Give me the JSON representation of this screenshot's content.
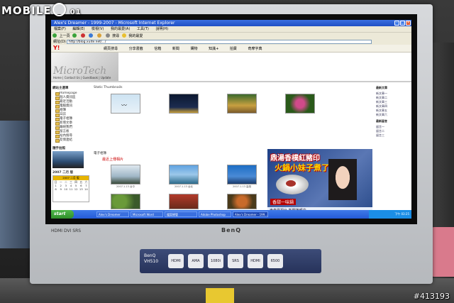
{
  "watermark": {
    "brand_prefix": "MOBILE",
    "brand_number": "01",
    "photo_id": "#413193"
  },
  "monitor": {
    "brand": "BenQ",
    "model": "BenQ\nVH510",
    "bezel_left_text": "HDMI  DVI  SRS",
    "badges": [
      "HDMI",
      "AMA",
      "1080i",
      "SRS",
      "HDMI",
      "6500"
    ]
  },
  "browser": {
    "title": "Alex's Dreamer - 1999-2007 - Microsoft Internet Explorer",
    "menu": [
      "檔案(F)",
      "編輯(E)",
      "檢視(V)",
      "我的最愛(A)",
      "工具(T)",
      "說明(H)"
    ],
    "toolbar_back": "上一頁",
    "toolbar_search": "搜尋",
    "toolbar_favorites": "我的最愛",
    "address_label": "網址(D)",
    "address_value": "http://blog.xuite.net/.../",
    "yahoo_label": "Y!",
    "yahoo_items": [
      "網頁搜尋",
      "分享書籤",
      "信箱",
      "新聞",
      "購物",
      "知識+",
      "拍賣",
      "奇摩字典"
    ]
  },
  "page": {
    "banner_text": "MicroTech",
    "banner_nav": "Home | Contact Us | Guestbook | Update",
    "gallery_title": "Static Thumbnails",
    "subtitle": "電子相簿",
    "subtitle2": "最近上傳相片",
    "left_nav_heading": "網站主選單",
    "left_nav_items": [
      "Homepage",
      "個人資訊區",
      "最近活動",
      "電腦資訊",
      "相簿",
      "日誌",
      "電子相簿",
      "新增文章",
      "聯絡我們",
      "留言板",
      "站內搜尋",
      "友情連結"
    ],
    "side_heading": "隨手拍照",
    "calendar_heading": "2007 二月 版",
    "calendar_days": [
      "日",
      "一",
      "二",
      "三",
      "四",
      "五",
      "六",
      "1",
      "2",
      "3",
      "4",
      "5",
      "6",
      "7",
      "8",
      "9",
      "10",
      "11",
      "12",
      "13",
      "14"
    ],
    "right_heading": "最新文章",
    "right_items": [
      "新文章一",
      "新文章二",
      "新文章三",
      "新文章四",
      "新文章五",
      "新文章六"
    ],
    "right_heading2": "最新留言",
    "right_items2": [
      "留言一",
      "留言二",
      "留言三"
    ],
    "thumb_captions": [
      "2007.1.13 台中",
      "2007.1.13 台北",
      "2007.1.13 高雄",
      "2007.1.13 台南"
    ]
  },
  "ad": {
    "title1": "鼎湯香樸紅豬印",
    "title2": "火鍋小妹子煮了",
    "subtitle": "香甜一味鍋",
    "ticker": "東森電視台 新聞播報中"
  },
  "taskbar": {
    "start_label": "start",
    "items": [
      "Alex's Dreamer",
      "Microsoft Word",
      "檔案總管",
      "Adobe Photoshop",
      "Alex's Dreamer - 199..."
    ],
    "clock": "下午 03:25"
  }
}
